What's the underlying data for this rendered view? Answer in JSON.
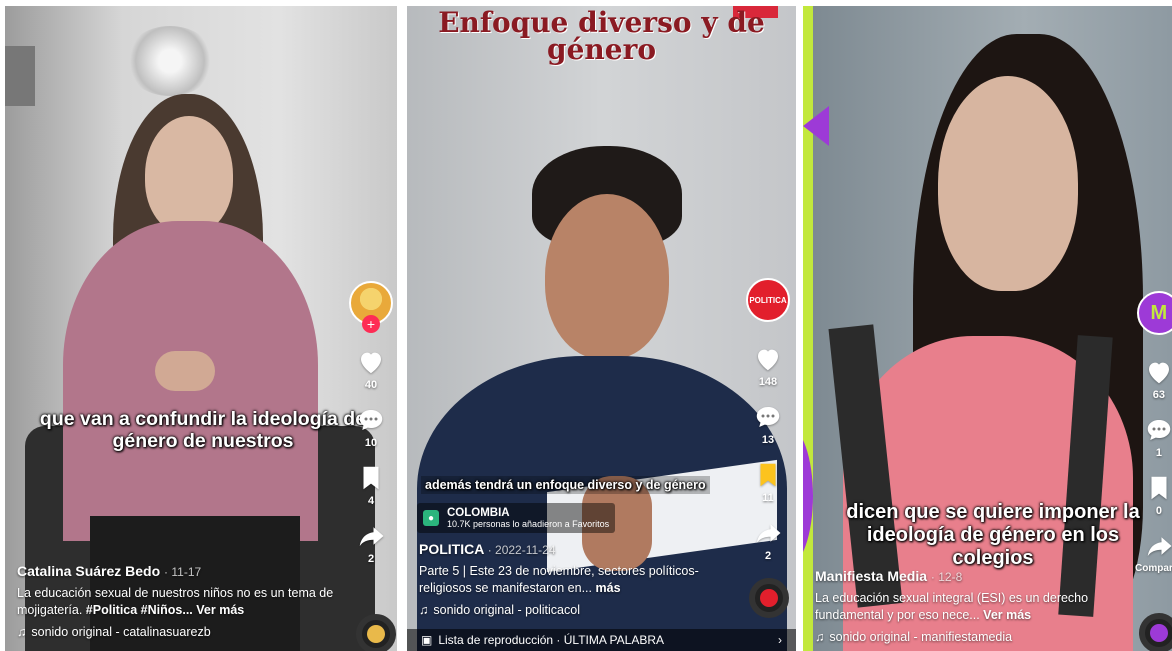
{
  "panels": [
    {
      "caption": "que van a confundir la ideología de género de nuestros",
      "author": "Catalina Suárez Bedo",
      "date": "· 11-17",
      "description": "La educación sexual de nuestros niños no es un tema de mojigatería.",
      "hashtags": "#Politica #Niños...",
      "more": "Ver más",
      "sound": "sonido original - catalinasuarezb",
      "likes": "40",
      "comments": "10",
      "saves": "4",
      "shares": "2"
    },
    {
      "header_title": "Enfoque diverso y de género",
      "caption": "además tendrá un enfoque diverso y de género",
      "location_name": "COLOMBIA",
      "location_sub": "10.7K personas lo añadieron a Favoritos",
      "avatar_text": "POLITICA",
      "author": "POLITICA",
      "date": "· 2022-11-24",
      "part": "Parte 5",
      "description": "Este 23 de noviembre, sectores políticos-religiosos se manifestaron en...",
      "more": "más",
      "sound": "sonido original - politicacol",
      "playlist": "Lista de reproducción · ÚLTIMA PALABRA",
      "likes": "148",
      "comments": "13",
      "saves": "11",
      "shares": "2"
    },
    {
      "caption": "dicen que se quiere imponer la ideología de género en los colegios",
      "author": "Manifiesta Media",
      "date": "· 12-8",
      "description": "La educación sexual integral (ESI) es un derecho fundamental y por eso nece...",
      "more": "Ver más",
      "sound": "sonido original - manifiestamedia",
      "avatar_text": "M",
      "likes": "63",
      "comments": "1",
      "saves": "0",
      "shares": "Compartir"
    }
  ],
  "colors": {
    "tiktok_red": "#fe2c55",
    "save_yellow": "#fcc31e",
    "headline_red": "#8a1a22",
    "accent_purple": "#9d3ad7",
    "accent_lime": "#c2e83c"
  }
}
